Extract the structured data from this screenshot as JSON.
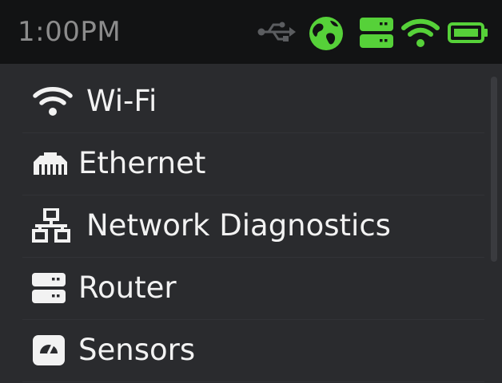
{
  "status_bar": {
    "time": "1:00PM",
    "icons": [
      "usb-icon",
      "globe-icon",
      "router-icon",
      "wifi-icon",
      "battery-icon"
    ],
    "accent_color": "#56d139",
    "usb_color": "#5b5d60"
  },
  "menu": {
    "items": [
      {
        "label": "Wi-Fi",
        "icon": "wifi-icon"
      },
      {
        "label": "Ethernet",
        "icon": "ethernet-icon"
      },
      {
        "label": "Network Diagnostics",
        "icon": "network-icon"
      },
      {
        "label": "Router",
        "icon": "router-icon"
      },
      {
        "label": "Sensors",
        "icon": "sensors-icon"
      }
    ]
  }
}
